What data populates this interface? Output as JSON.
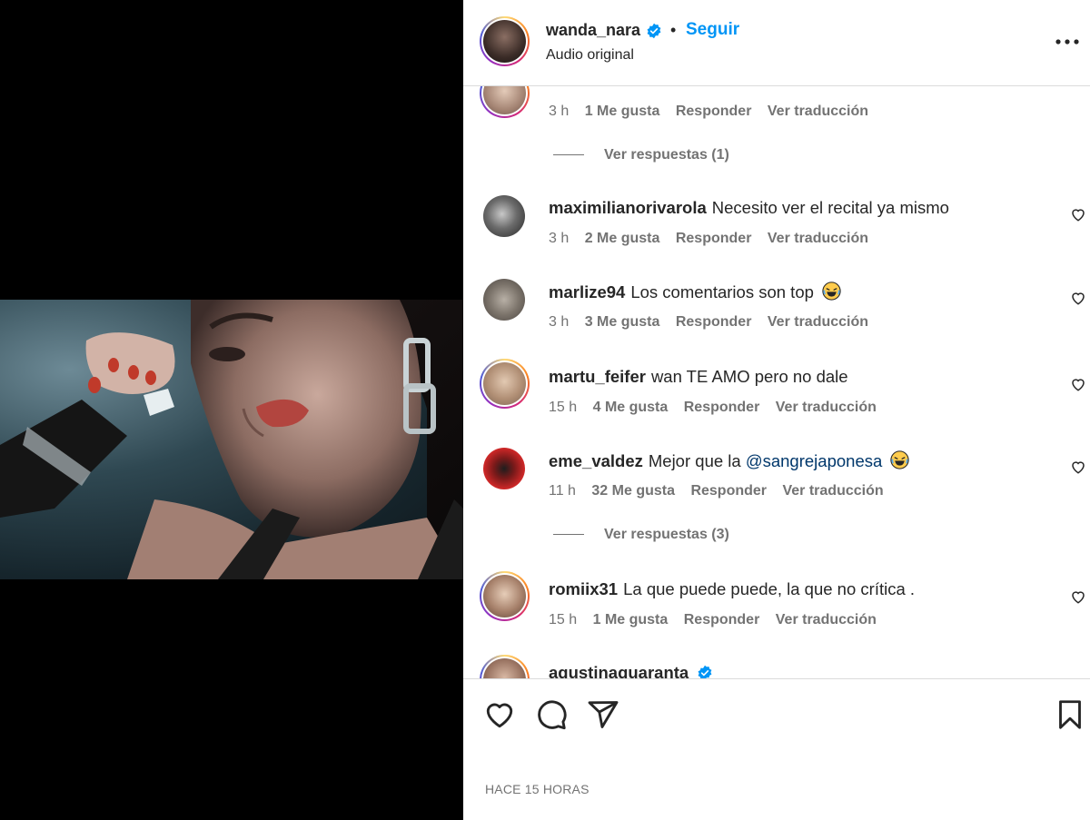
{
  "post": {
    "username": "wanda_nara",
    "follow_label": "Seguir",
    "separator": "•",
    "audio": "Audio original",
    "posted_time": "HACE 15 HORAS"
  },
  "comments": [
    {
      "username": "",
      "text": "",
      "time": "3 h",
      "likes": "1 Me gusta",
      "reply": "Responder",
      "translate": "Ver traducción",
      "view_replies": "Ver respuestas (1)"
    },
    {
      "username": "maximilianorivarola",
      "text": "Necesito ver el recital ya mismo",
      "time": "3 h",
      "likes": "2 Me gusta",
      "reply": "Responder",
      "translate": "Ver traducción"
    },
    {
      "username": "marlize94",
      "text": "Los comentarios son top",
      "emoji": "laughing-emoji",
      "time": "3 h",
      "likes": "3 Me gusta",
      "reply": "Responder",
      "translate": "Ver traducción"
    },
    {
      "username": "martu_feifer",
      "text": "wan TE AMO pero no dale",
      "time": "15 h",
      "likes": "4 Me gusta",
      "reply": "Responder",
      "translate": "Ver traducción"
    },
    {
      "username": "eme_valdez",
      "text": "Mejor que la",
      "mention": "@sangrejaponesa",
      "emoji": "laughing-emoji",
      "time": "11 h",
      "likes": "32 Me gusta",
      "reply": "Responder",
      "translate": "Ver traducción",
      "view_replies": "Ver respuestas (3)"
    },
    {
      "username": "romiix31",
      "text": "La que puede puede, la que no crítica .",
      "time": "15 h",
      "likes": "1 Me gusta",
      "reply": "Responder",
      "translate": "Ver traducción"
    },
    {
      "username": "agustinaquaranta",
      "text": "",
      "verified": true
    }
  ],
  "icons": {
    "verified": "verified-badge-icon",
    "more": "more-options-icon",
    "like": "heart-icon",
    "comment": "comment-icon",
    "share": "share-icon",
    "save": "bookmark-icon"
  },
  "colors": {
    "accent": "#0095f6",
    "verified": "#0095f6",
    "meta_text": "#737373",
    "primary_text": "#262626"
  }
}
